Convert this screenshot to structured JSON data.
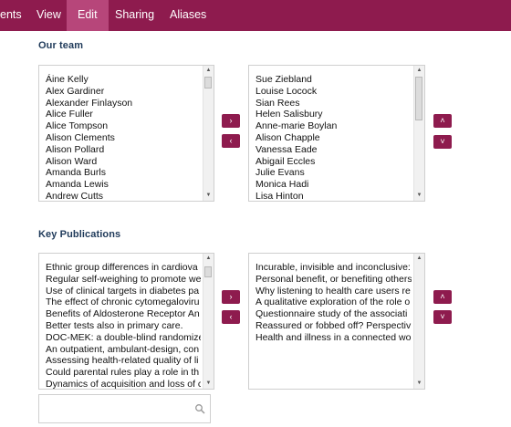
{
  "nav": {
    "tabs": [
      {
        "label": "ents"
      },
      {
        "label": "View"
      },
      {
        "label": "Edit"
      },
      {
        "label": "Sharing"
      },
      {
        "label": "Aliases"
      }
    ]
  },
  "team": {
    "title": "Our team",
    "available": [
      "Áine Kelly",
      "Alex Gardiner",
      "Alexander Finlayson",
      "Alice Fuller",
      "Alice Tompson",
      "Alison Clements",
      "Alison Pollard",
      "Alison Ward",
      "Amanda Burls",
      "Amanda Lewis",
      "Andrew Cutts"
    ],
    "selected": [
      "Sue Ziebland",
      "Louise Locock",
      "Sian Rees",
      "Helen Salisbury",
      "Anne-marie Boylan",
      "Alison Chapple",
      "Vanessa Eade",
      "Abigail Eccles",
      "Julie Evans",
      "Monica Hadi",
      "Lisa Hinton"
    ]
  },
  "publications": {
    "title": "Key Publications",
    "available": [
      "Ethnic group differences in cardiova",
      "Regular self-weighing to promote we",
      "Use of clinical targets in diabetes pa",
      "The effect of chronic cytomegaloviru",
      "Benefits of Aldosterone Receptor An",
      "Better tests also in primary care.",
      "DOC-MEK: a double-blind randomize",
      "An outpatient, ambulant-design, con",
      "Assessing health-related quality of li",
      "Could parental rules play a role in th",
      "Dynamics of acquisition and loss of c"
    ],
    "selected": [
      "Incurable, invisible and inconclusive:",
      "Personal benefit, or benefiting others",
      "Why listening to health care users re",
      "A qualitative exploration of the role o",
      "Questionnaire study of the associati",
      "Reassured or fobbed off? Perspectiv",
      "Health and illness in a connected wo"
    ]
  },
  "buttons": {
    "add": "›",
    "remove": "‹",
    "up": "˄",
    "down": "˅"
  },
  "search": {
    "value": "",
    "placeholder": ""
  }
}
